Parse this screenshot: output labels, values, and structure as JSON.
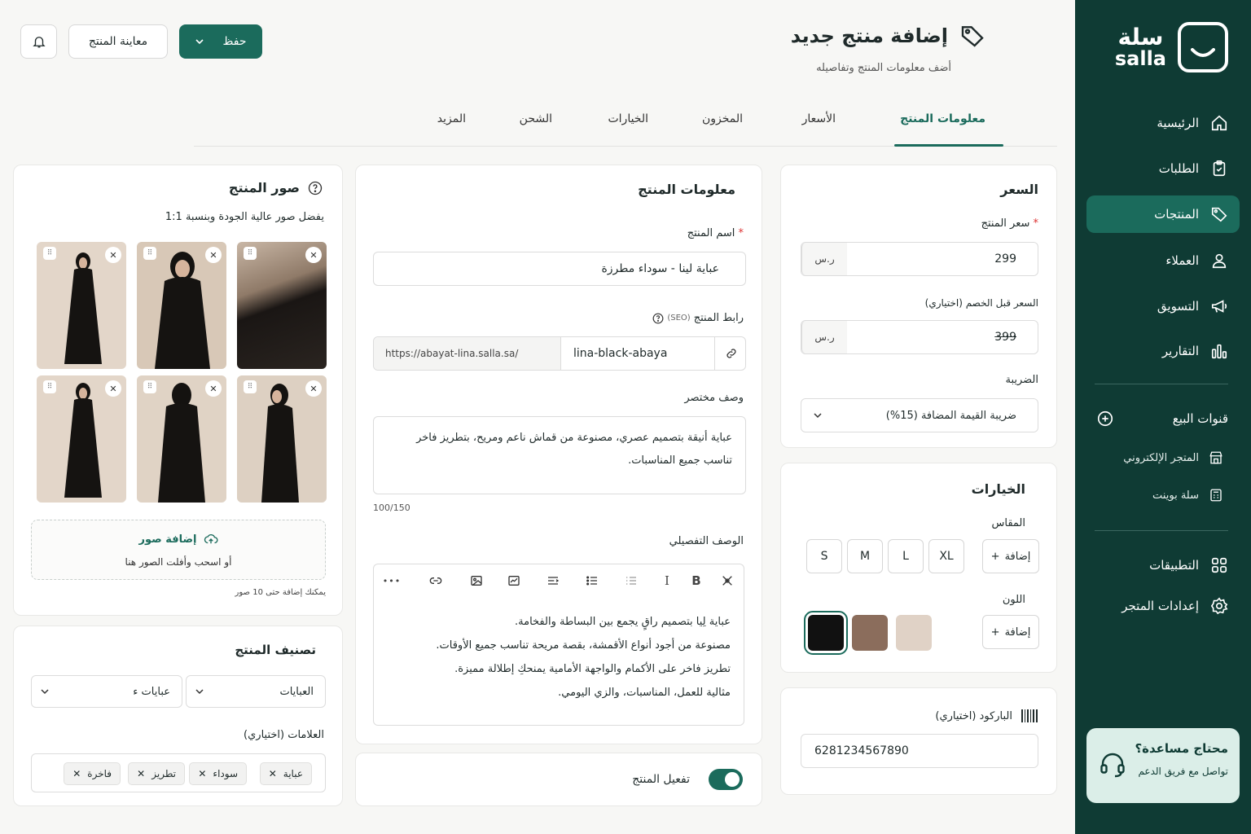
{
  "brand": {
    "logo_ar": "سلة",
    "logo_en": "salla"
  },
  "sidebar": {
    "items": [
      {
        "label": "الرئيسية"
      },
      {
        "label": "الطلبات"
      },
      {
        "label": "المنتجات"
      },
      {
        "label": "العملاء"
      },
      {
        "label": "التسويق"
      },
      {
        "label": "التقارير"
      }
    ],
    "channels_label": "قنوات البيع",
    "channels": [
      {
        "label": "المتجر الإلكتروني"
      },
      {
        "label": "سلة بوينت"
      }
    ],
    "apps_label": "التطبيقات",
    "settings_label": "إعدادات المتجر",
    "help": {
      "title": "محتاج مساعدة؟",
      "subtitle": "تواصل مع فريق الدعم"
    }
  },
  "header": {
    "title": "إضافة منتج جديد",
    "subtitle": "أضف معلومات المنتج وتفاصيله",
    "save_label": "حفظ",
    "preview_label": "معاينة المنتج"
  },
  "tabs": [
    {
      "label": "معلومات المنتج",
      "active": true
    },
    {
      "label": "الأسعار"
    },
    {
      "label": "المخزون"
    },
    {
      "label": "الخيارات"
    },
    {
      "label": "الشحن"
    },
    {
      "label": "المزيد"
    }
  ],
  "price": {
    "title": "السعر",
    "price_label": "سعر المنتج",
    "price_value": "299",
    "currency": "ر.س",
    "compare_label": "السعر قبل الخصم (اختياري)",
    "compare_value": "399",
    "tax_label": "الضريبة",
    "tax_value": "ضريبة القيمة المضافة (15%)"
  },
  "options": {
    "title": "الخيارات",
    "size_label": "المقاس",
    "sizes": [
      "S",
      "M",
      "L",
      "XL"
    ],
    "add_label": "إضافة",
    "color_label": "اللون",
    "colors": [
      "#111111",
      "#8b6d5c",
      "#e0d2c6"
    ]
  },
  "barcode": {
    "label": "الباركود (اختياري)",
    "value": "6281234567890"
  },
  "info": {
    "title": "معلومات المنتج",
    "name_label": "اسم المنتج",
    "name_value": "عباية لينا - سوداء مطرزة",
    "url_label": "رابط المنتج",
    "url_hint": "(SEO)",
    "url_base": "https://abayat-lina.salla.sa/",
    "url_slug": "lina-black-abaya",
    "short_label": "وصف مختصر",
    "short_lines": [
      "عباية أنيقة بتصميم عصري، مصنوعة من قماش ناعم ومريح، بتطريز فاخر",
      "تناسب جميع المناسبات."
    ],
    "short_count": "100/150",
    "detail_label": "الوصف التفصيلي",
    "detail_lines": [
      "عباية لِيا بتصميم راقٍ يجمع بين البساطة والفخامة.",
      "مصنوعة من أجود أنواع الأقمشة، بقصة مريحة تناسب جميع الأوقات.",
      "تطريز فاخر على الأكمام والواجهة الأمامية يمنحكِ إطلالة مميزة.",
      "مثالية للعمل، المناسبات، والزي اليومي."
    ],
    "toolbar_bold": "B",
    "toolbar_italic": "I",
    "toolbar_more": "•••"
  },
  "activate": {
    "label": "تفعيل المنتج",
    "enabled": true
  },
  "images": {
    "title": "صور المنتج",
    "hint": "يفضل صور عالية الجودة وبنسبة 1:1",
    "add_label": "إضافة صور",
    "drop_label": "أو اسحب وأفلت الصور هنا",
    "limit_label": "يمكنك إضافة حتى 10 صور"
  },
  "classification": {
    "title": "تصنيف المنتج",
    "category": "العبايات",
    "subcategory": "عبايات ء",
    "tags_label": "العلامات (اختياري)",
    "tags": [
      "عباية",
      "سوداء",
      "تطريز",
      "فاخرة"
    ]
  }
}
